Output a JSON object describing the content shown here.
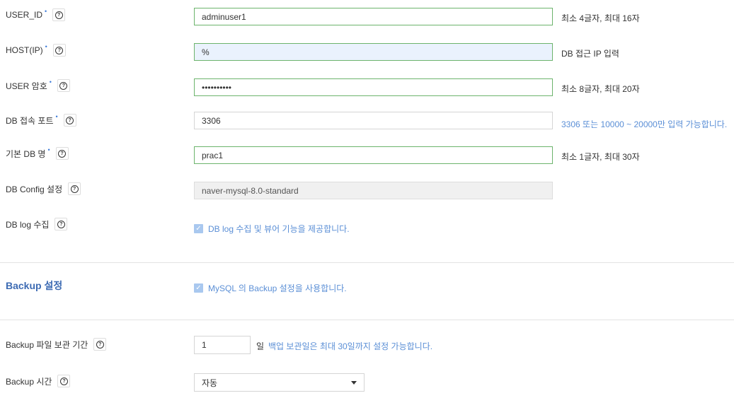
{
  "fields": {
    "user_id": {
      "label": "USER_ID",
      "value": "adminuser1",
      "hint": "최소 4글자, 최대 16자"
    },
    "host": {
      "label": "HOST(IP)",
      "value": "%",
      "hint": "DB 접근 IP 입력"
    },
    "password": {
      "label": "USER 암호",
      "value": "••••••••••",
      "hint": "최소 8글자, 최대 20자"
    },
    "port": {
      "label": "DB 접속 포트",
      "value": "3306",
      "hint": "3306 또는 10000 ~ 20000만 입력 가능합니다."
    },
    "default_db": {
      "label": "기본 DB 명",
      "value": "prac1",
      "hint": "최소 1글자, 최대 30자"
    },
    "config": {
      "label": "DB Config 설정",
      "value": "naver-mysql-8.0-standard"
    },
    "log": {
      "label": "DB log 수집",
      "checkbox_label": "DB log 수집 및 뷰어 기능을 제공합니다."
    }
  },
  "required_mark": "•",
  "help_glyph": "?",
  "check_glyph": "✓",
  "backup": {
    "title": "Backup 설정",
    "checkbox_label": "MySQL 의 Backup 설정을 사용합니다.",
    "retention": {
      "label": "Backup 파일 보관 기간",
      "value": "1",
      "unit": "일",
      "hint": "백업 보관일은 최대 30일까지 설정 가능합니다."
    },
    "time": {
      "label": "Backup 시간",
      "selected": "자동"
    }
  },
  "colors": {
    "accent": "#3d6bb3",
    "valid_border": "#6cb46c",
    "hint_blue": "#5b8fd6"
  }
}
